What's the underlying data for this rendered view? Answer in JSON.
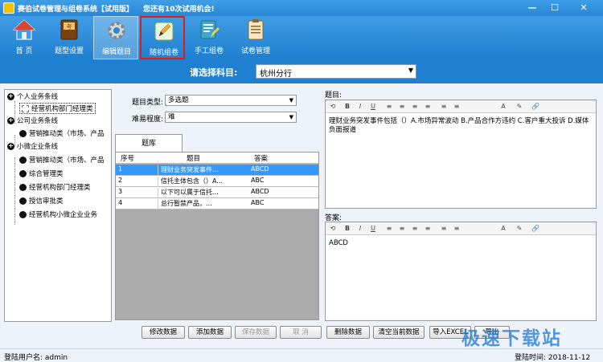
{
  "window": {
    "title": "赛伯试卷管理与组卷系统【试用版】",
    "trial_message": "您还有10次试用机会!",
    "minimize": "—",
    "maximize": "☐",
    "close": "✕"
  },
  "toolbar": {
    "items": [
      {
        "label": "首 页",
        "icon": "home-icon"
      },
      {
        "label": "题型设置",
        "icon": "book-icon"
      },
      {
        "label": "编辑题目",
        "icon": "gear-icon"
      },
      {
        "label": "随机组卷",
        "icon": "pencil-note-icon"
      },
      {
        "label": "手工组卷",
        "icon": "clipboard-edit-icon"
      },
      {
        "label": "试卷管理",
        "icon": "document-list-icon"
      }
    ]
  },
  "subject": {
    "label": "请选择科目:",
    "value": "杭州分行"
  },
  "tree": {
    "nodes": [
      {
        "label": "个人业务条线",
        "type": "expand",
        "symbol": "+"
      },
      {
        "label": "经营机构部门经理类",
        "type": "leaf-selected"
      },
      {
        "label": "公司业务条线",
        "type": "expand",
        "symbol": "+"
      },
      {
        "label": "营销推动类（市场、产品",
        "type": "leaf"
      },
      {
        "label": "小微企业条线",
        "type": "expand",
        "symbol": "+"
      },
      {
        "label": "营销推动类（市场、产品",
        "type": "leaf"
      },
      {
        "label": "综合管理类",
        "type": "leaf"
      },
      {
        "label": "经营机构部门经理类",
        "type": "leaf"
      },
      {
        "label": "授信审批类",
        "type": "leaf"
      },
      {
        "label": "经营机构小微企业业务",
        "type": "leaf"
      }
    ]
  },
  "form": {
    "type_label": "题目类型:",
    "type_value": "多选题",
    "difficulty_label": "难易程度:",
    "difficulty_value": "难"
  },
  "bank": {
    "tab_label": "题库",
    "columns": [
      "序号",
      "题目",
      "答案"
    ],
    "rows": [
      {
        "no": "1",
        "question": "理财业务突发事件...",
        "answer": "ABCD"
      },
      {
        "no": "2",
        "question": "信托主体包含（）A...",
        "answer": "ABC"
      },
      {
        "no": "3",
        "question": "以下可以属于信托...",
        "answer": "ABCD"
      },
      {
        "no": "4",
        "question": "总行暂禁产品，...",
        "answer": "ABC"
      }
    ]
  },
  "editors": {
    "question_label": "题目:",
    "question_text": "理财业务突发事件包括（）A.市场异常波动 B.产品合作方违约 C.客户重大投诉 D.媒体负面报道",
    "answer_label": "答案:",
    "answer_text": "ABCD",
    "toolbar_glyphs": [
      "⟲",
      "B",
      "I",
      "U",
      "≡",
      "≡",
      "≡",
      "≡",
      "≡",
      "≡",
      "A",
      "✎",
      "🔗"
    ]
  },
  "buttons": {
    "modify": "修改数据",
    "add": "添加数据",
    "save": "保存数据",
    "cancel": "取 消",
    "delete": "删除数据",
    "clear": "清空当前数据",
    "import": "导入EXCEL",
    "export": "导出"
  },
  "status": {
    "user": "登陆用户名: admin",
    "time": "登陆时间: 2018-11-12"
  },
  "watermark": "极速下载站"
}
